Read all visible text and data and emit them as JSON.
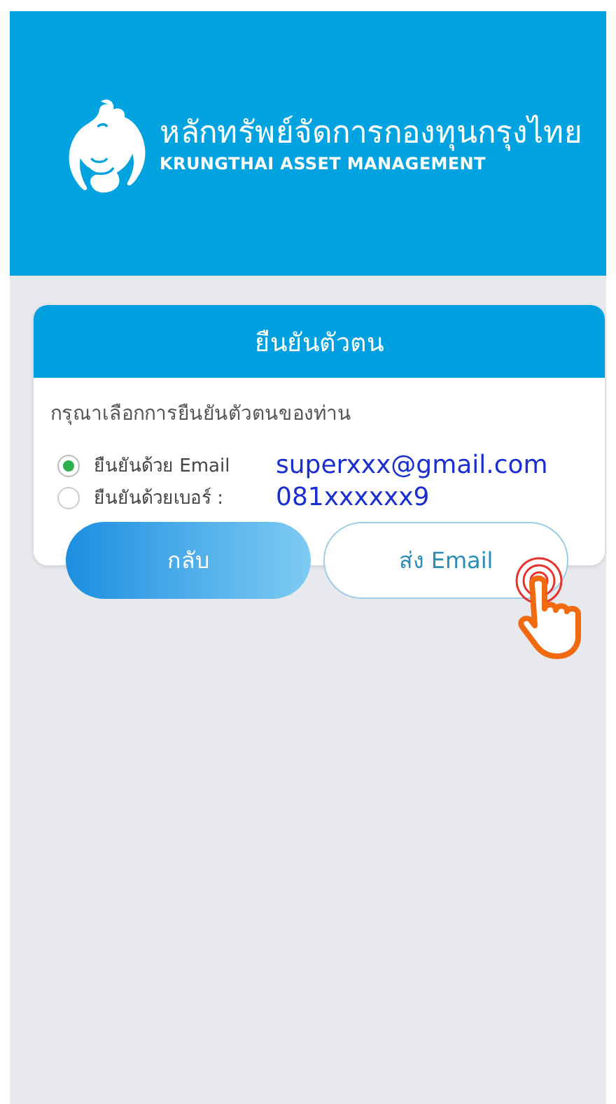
{
  "header": {
    "logo_thai": "หลักทรัพย์จัดการกองทุนกรุงไทย",
    "logo_english": "KRUNGTHAI ASSET MANAGEMENT"
  },
  "dialog": {
    "title": "ยืนยันตัวตน",
    "prompt": "กรุณาเลือกการยืนยันตัวตนของท่าน",
    "options": [
      {
        "label": "ยืนยันด้วย Email",
        "value": "superxxx@gmail.com",
        "selected": true
      },
      {
        "label": "ยืนยันด้วยเบอร์ :",
        "value": "081xxxxxx9",
        "selected": false
      }
    ],
    "buttons": [
      {
        "label": "กลับ",
        "kind": "primary"
      },
      {
        "label": "ส่ง Email",
        "kind": "outline"
      }
    ]
  }
}
